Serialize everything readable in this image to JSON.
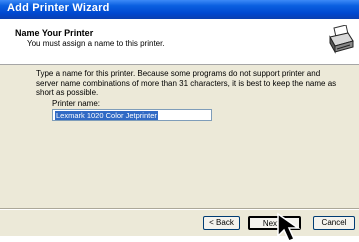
{
  "window": {
    "title": "Add Printer Wizard"
  },
  "header": {
    "title": "Name Your Printer",
    "subtitle": "You must assign a name to this printer.",
    "icon": "printer-icon"
  },
  "body": {
    "description": "Type a name for this printer. Because some programs do not support printer and server name combinations of more than 31 characters, it is best to keep the name as short as possible.",
    "printer_name_label": "Printer name:",
    "printer_name_value": "Lexmark 1020 Color Jetprinter"
  },
  "buttons": {
    "back": "< Back",
    "next": "Next >",
    "cancel": "Cancel"
  },
  "colors": {
    "titlebar": "#0a5fe0",
    "selection": "#316ac5",
    "dialog_bg": "#ece9d8"
  }
}
